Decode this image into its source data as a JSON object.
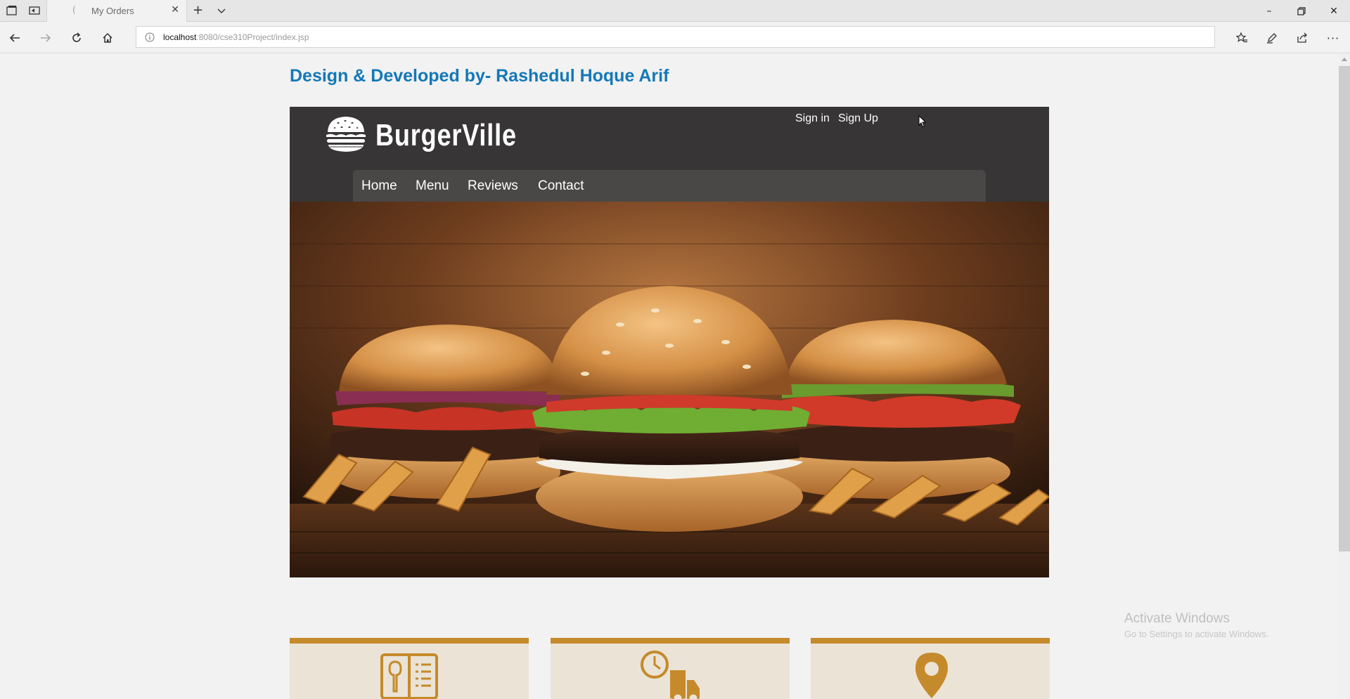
{
  "browser": {
    "tab_title": "My Orders",
    "url_host": "localhost",
    "url_rest": ":8080/cse310Project/index.jsp"
  },
  "page": {
    "credit_text": "Design & Developed by- Rashedul Hoque Arif",
    "brand_name": "BurgerVille",
    "auth": {
      "sign_in": "Sign in",
      "sign_up": "Sign Up"
    },
    "menu": [
      {
        "label": "Home"
      },
      {
        "label": "Menu"
      },
      {
        "label": "Reviews"
      },
      {
        "label": "Contact"
      }
    ],
    "hero_alt": "three burgers with fries on a wooden board",
    "features": [
      {
        "icon": "menu-book-icon"
      },
      {
        "icon": "delivery-truck-icon"
      },
      {
        "icon": "location-pin-icon"
      }
    ]
  },
  "windows_watermark": {
    "title": "Activate Windows",
    "subtitle": "Go to Settings to activate Windows."
  },
  "colors": {
    "credit_blue": "#1478b8",
    "header_dark": "#373535",
    "feature_accent": "#c58a2b",
    "feature_bg": "#ebe3d6"
  }
}
